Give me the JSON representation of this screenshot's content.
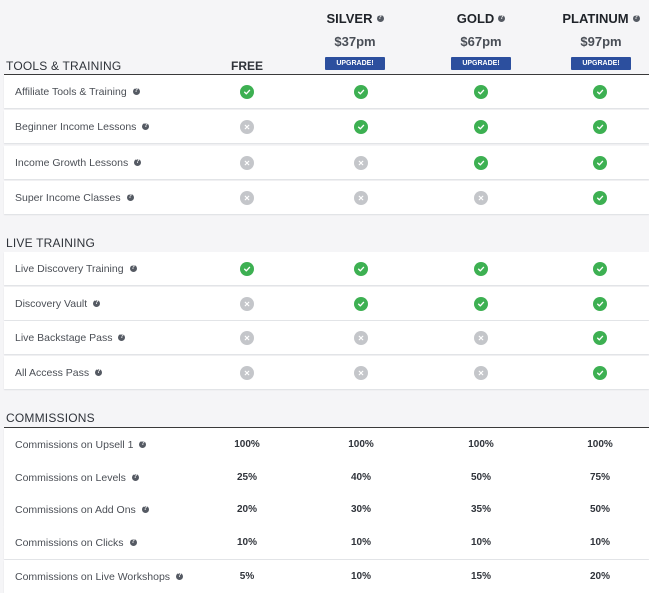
{
  "plans": [
    {
      "name": "SILVER",
      "price": "$37pm",
      "button": "UPGRADE!"
    },
    {
      "name": "GOLD",
      "price": "$67pm",
      "button": "UPGRADE!"
    },
    {
      "name": "PLATINUM",
      "price": "$97pm",
      "button": "UPGRADE!"
    }
  ],
  "free_label": "FREE",
  "sections": [
    {
      "title": "TOOLS & TRAINING",
      "rows": [
        {
          "label": "Affiliate Tools & Training",
          "cells": [
            "check",
            "check",
            "check",
            "check"
          ]
        },
        {
          "label": "Beginner Income Lessons",
          "cells": [
            "x",
            "check",
            "check",
            "check"
          ]
        },
        {
          "label": "Income Growth Lessons",
          "cells": [
            "x",
            "x",
            "check",
            "check"
          ]
        },
        {
          "label": "Super Income Classes",
          "cells": [
            "x",
            "x",
            "x",
            "check"
          ]
        }
      ]
    },
    {
      "title": "LIVE TRAINING",
      "rows": [
        {
          "label": "Live Discovery Training",
          "cells": [
            "check",
            "check",
            "check",
            "check"
          ]
        },
        {
          "label": "Discovery Vault",
          "cells": [
            "x",
            "check",
            "check",
            "check"
          ]
        },
        {
          "label": "Live Backstage Pass",
          "cells": [
            "x",
            "x",
            "x",
            "check"
          ]
        },
        {
          "label": "All Access Pass",
          "cells": [
            "x",
            "x",
            "x",
            "check"
          ]
        }
      ]
    },
    {
      "title": "COMMISSIONS",
      "rows": [
        {
          "label": "Commissions on Upsell 1",
          "cells": [
            "100%",
            "100%",
            "100%",
            "100%"
          ]
        },
        {
          "label": "Commissions on Levels",
          "cells": [
            "25%",
            "40%",
            "50%",
            "75%"
          ]
        },
        {
          "label": "Commissions on Add Ons",
          "cells": [
            "20%",
            "30%",
            "35%",
            "50%"
          ]
        },
        {
          "label": "Commissions on Clicks",
          "cells": [
            "10%",
            "10%",
            "10%",
            "10%"
          ]
        },
        {
          "label": "Commissions on Live Workshops",
          "cells": [
            "5%",
            "10%",
            "15%",
            "20%"
          ]
        }
      ]
    }
  ],
  "help_glyph": "?",
  "colors": {
    "check": "#3db052",
    "x": "#c4c6ca",
    "upgrade": "#2c4f9e"
  }
}
